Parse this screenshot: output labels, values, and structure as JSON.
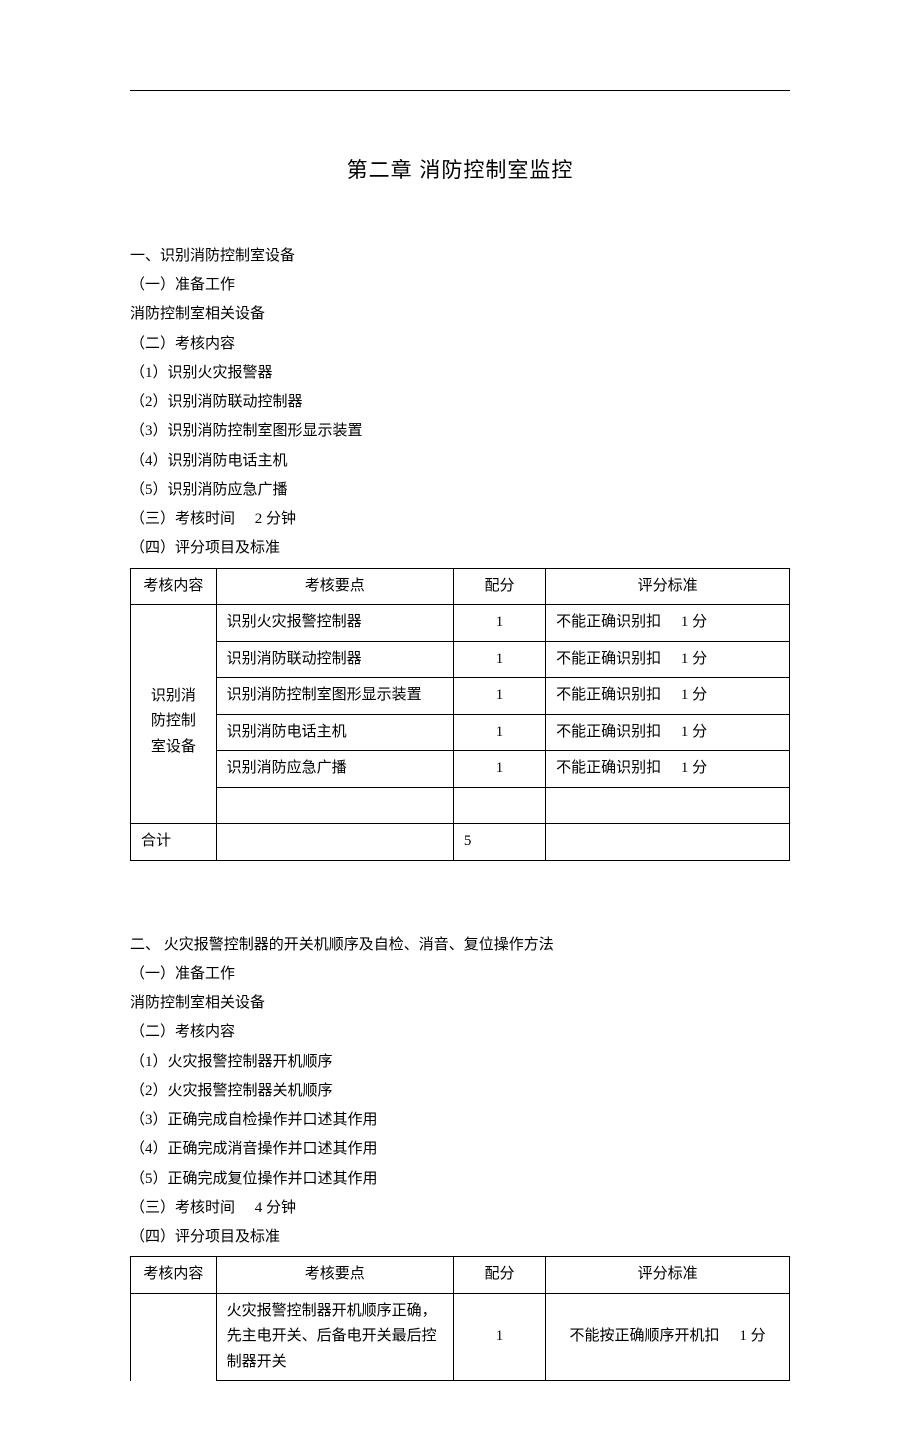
{
  "title": "第二章  消防控制室监控",
  "section1": {
    "heading": "一、识别消防控制室设备",
    "prep_label": "（一）准备工作",
    "prep_text": "消防控制室相关设备",
    "content_label": "（二）考核内容",
    "items": [
      "（1）识别火灾报警器",
      "（2）识别消防联动控制器",
      "（3）识别消防控制室图形显示装置",
      "（4）识别消防电话主机",
      "（5）识别消防应急广播"
    ],
    "time_prefix": "（三）考核时间",
    "time_value": "2 分钟",
    "std_label": "（四）评分项目及标准",
    "table": {
      "headers": [
        "考核内容",
        "考核要点",
        "配分",
        "评分标准"
      ],
      "group_label_lines": [
        "识别消",
        "防控制",
        "室设备"
      ],
      "rows": [
        {
          "point": "识别火灾报警控制器",
          "score": "1",
          "std_prefix": "不能正确识别扣",
          "std_suffix": "1 分"
        },
        {
          "point": "识别消防联动控制器",
          "score": "1",
          "std_prefix": "不能正确识别扣",
          "std_suffix": "1 分"
        },
        {
          "point": "识别消防控制室图形显示装置",
          "score": "1",
          "std_prefix": "不能正确识别扣",
          "std_suffix": "1 分"
        },
        {
          "point": "识别消防电话主机",
          "score": "1",
          "std_prefix": "不能正确识别扣",
          "std_suffix": "1 分"
        },
        {
          "point": "识别消防应急广播",
          "score": "1",
          "std_prefix": "不能正确识别扣",
          "std_suffix": "1 分"
        }
      ],
      "sum_label": "合计",
      "sum_value": "5"
    }
  },
  "section2": {
    "heading": "二、  火灾报警控制器的开关机顺序及自检、消音、复位操作方法",
    "prep_label": "（一）准备工作",
    "prep_text": "消防控制室相关设备",
    "content_label": "（二）考核内容",
    "items": [
      "（1）火灾报警控制器开机顺序",
      "（2）火灾报警控制器关机顺序",
      "（3）正确完成自检操作并口述其作用",
      "（4）正确完成消音操作并口述其作用",
      "（5）正确完成复位操作并口述其作用"
    ],
    "time_prefix": "（三）考核时间",
    "time_value": "4 分钟",
    "std_label": "（四）评分项目及标准",
    "table": {
      "headers": [
        "考核内容",
        "考核要点",
        "配分",
        "评分标准"
      ],
      "row1": {
        "point": "火灾报警控制器开机顺序正确，先主电开关、后备电开关最后控制器开关",
        "score": "1",
        "std_prefix": "不能按正确顺序开机扣",
        "std_suffix": "1 分"
      }
    }
  }
}
